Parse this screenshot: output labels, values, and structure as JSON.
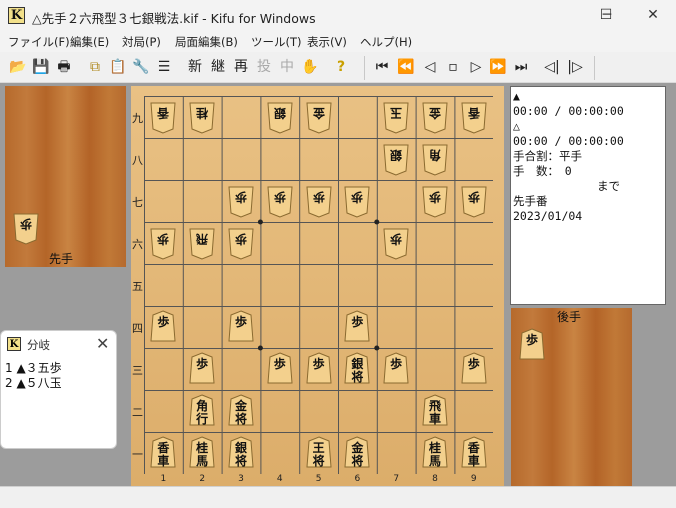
{
  "window": {
    "title": "△先手２六飛型３七銀戦法.kif - Kifu for Windows",
    "icon": "K",
    "controls": {
      "minimize": "─",
      "maximize": "☐",
      "close": "✕"
    }
  },
  "menu": [
    "ファイル(F)",
    "編集(E)",
    "対局(P)",
    "局面編集(B)",
    "ツール(T)",
    "表示(V)",
    "ヘルプ(H)"
  ],
  "toolbar": {
    "open": "📂",
    "save": "💾",
    "print": "🖶",
    "copy": "⧉",
    "paste": "📋",
    "settings": "🔧",
    "list": "☰",
    "new": "新",
    "continue": "継",
    "replay": "再",
    "resign": "投",
    "pause": "中",
    "hand": "✋",
    "help": "?",
    "nav": [
      "⏮",
      "⏪",
      "◁",
      "▫",
      "▷",
      "⏩",
      "⏭",
      "◁|",
      "|▷"
    ]
  },
  "board": {
    "ranks": [
      "九",
      "八",
      "七",
      "六",
      "五",
      "四",
      "三",
      "二",
      "一"
    ],
    "files": [
      "1",
      "2",
      "3",
      "4",
      "5",
      "6",
      "7",
      "8",
      "9"
    ],
    "pieces": [
      {
        "t": "香",
        "c": "",
        "u": true,
        "f": 0,
        "r": 0
      },
      {
        "t": "桂",
        "c": "",
        "u": true,
        "f": 1,
        "r": 0
      },
      {
        "t": "銀",
        "c": "",
        "u": true,
        "f": 3,
        "r": 0
      },
      {
        "t": "金",
        "c": "",
        "u": true,
        "f": 4,
        "r": 0
      },
      {
        "t": "玉",
        "c": "",
        "u": true,
        "f": 6,
        "r": 0
      },
      {
        "t": "金",
        "c": "",
        "u": true,
        "f": 7,
        "r": 0
      },
      {
        "t": "香",
        "c": "",
        "u": true,
        "f": 8,
        "r": 0
      },
      {
        "t": "銀",
        "c": "",
        "u": true,
        "f": 6,
        "r": 1
      },
      {
        "t": "角",
        "c": "",
        "u": true,
        "f": 7,
        "r": 1
      },
      {
        "t": "歩",
        "c": "",
        "u": true,
        "f": 2,
        "r": 2
      },
      {
        "t": "歩",
        "c": "",
        "u": true,
        "f": 3,
        "r": 2
      },
      {
        "t": "歩",
        "c": "",
        "u": true,
        "f": 4,
        "r": 2
      },
      {
        "t": "歩",
        "c": "",
        "u": true,
        "f": 5,
        "r": 2
      },
      {
        "t": "歩",
        "c": "",
        "u": true,
        "f": 7,
        "r": 2
      },
      {
        "t": "歩",
        "c": "",
        "u": true,
        "f": 8,
        "r": 2
      },
      {
        "t": "歩",
        "c": "",
        "u": true,
        "f": 0,
        "r": 3
      },
      {
        "t": "飛",
        "c": "",
        "u": true,
        "f": 1,
        "r": 3
      },
      {
        "t": "歩",
        "c": "",
        "u": true,
        "f": 2,
        "r": 3
      },
      {
        "t": "歩",
        "c": "",
        "u": true,
        "f": 6,
        "r": 3
      },
      {
        "t": "歩",
        "c": "",
        "u": false,
        "f": 0,
        "r": 5
      },
      {
        "t": "歩",
        "c": "",
        "u": false,
        "f": 2,
        "r": 5
      },
      {
        "t": "歩",
        "c": "",
        "u": false,
        "f": 5,
        "r": 5
      },
      {
        "t": "歩",
        "c": "",
        "u": false,
        "f": 1,
        "r": 6
      },
      {
        "t": "歩",
        "c": "",
        "u": false,
        "f": 3,
        "r": 6
      },
      {
        "t": "歩",
        "c": "",
        "u": false,
        "f": 4,
        "r": 6
      },
      {
        "t": "銀",
        "c": "将",
        "u": false,
        "f": 5,
        "r": 6
      },
      {
        "t": "歩",
        "c": "",
        "u": false,
        "f": 6,
        "r": 6
      },
      {
        "t": "歩",
        "c": "",
        "u": false,
        "f": 8,
        "r": 6
      },
      {
        "t": "角",
        "c": "行",
        "u": false,
        "f": 1,
        "r": 7
      },
      {
        "t": "金",
        "c": "将",
        "u": false,
        "f": 2,
        "r": 7
      },
      {
        "t": "飛",
        "c": "車",
        "u": false,
        "f": 7,
        "r": 7
      },
      {
        "t": "香",
        "c": "車",
        "u": false,
        "f": 0,
        "r": 8
      },
      {
        "t": "桂",
        "c": "馬",
        "u": false,
        "f": 1,
        "r": 8
      },
      {
        "t": "銀",
        "c": "将",
        "u": false,
        "f": 2,
        "r": 8
      },
      {
        "t": "王",
        "c": "将",
        "u": false,
        "f": 4,
        "r": 8
      },
      {
        "t": "金",
        "c": "将",
        "u": false,
        "f": 5,
        "r": 8
      },
      {
        "t": "桂",
        "c": "馬",
        "u": false,
        "f": 7,
        "r": 8
      },
      {
        "t": "香",
        "c": "車",
        "u": false,
        "f": 8,
        "r": 8
      }
    ]
  },
  "stands": {
    "top": {
      "label": "先手",
      "pieces": [
        {
          "t": "歩",
          "c": ""
        }
      ]
    },
    "bottom": {
      "label": "後手",
      "pieces": [
        {
          "t": "歩",
          "c": ""
        }
      ]
    }
  },
  "info": {
    "black_mark": "▲",
    "black_time": "00:00 / 00:00:00",
    "white_mark": "△",
    "white_time": "00:00 / 00:00:00",
    "handicap": "手合割：平手",
    "moves": "手　数：　0",
    "until": "まで",
    "turn": "先手番",
    "date": "2023/01/04"
  },
  "branch": {
    "title": "分岐",
    "close": "✕",
    "items": [
      "1 ▲３五歩",
      "2 ▲５八玉"
    ]
  },
  "colors": {
    "board": "#e3b677",
    "piece": "#f3d08d",
    "wood": "#b96d2f"
  }
}
